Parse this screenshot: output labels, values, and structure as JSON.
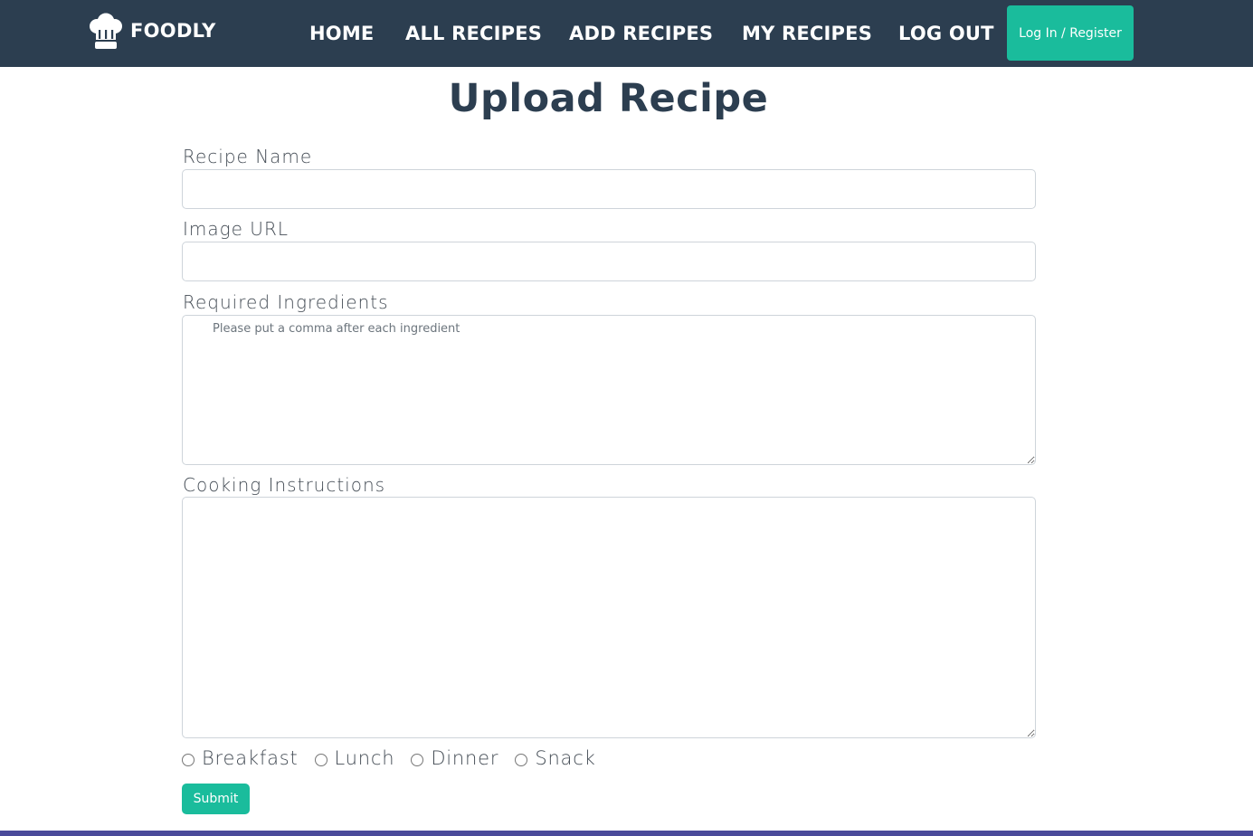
{
  "navbar": {
    "brand": "FOODLY",
    "brand_icon": "chef-hat-icon",
    "links": [
      "HOME",
      "ALL RECIPES",
      "ADD RECIPES",
      "MY RECIPES",
      "LOG OUT"
    ],
    "login_button": "Log In / Register",
    "background_color": "#2c3e50"
  },
  "page": {
    "title": "Upload Recipe"
  },
  "form": {
    "recipe_name": {
      "label": "Recipe Name",
      "value": ""
    },
    "image_url": {
      "label": "Image URL",
      "value": ""
    },
    "ingredients": {
      "label": "Required Ingredients",
      "placeholder": "Please put a comma after each ingredient",
      "value": ""
    },
    "instructions": {
      "label": "Cooking Instructions",
      "value": ""
    },
    "meal_types": [
      "Breakfast",
      "Lunch",
      "Dinner",
      "Snack"
    ],
    "submit_label": "Submit"
  },
  "colors": {
    "accent": "#1abc9c",
    "title": "#2c3e50"
  }
}
